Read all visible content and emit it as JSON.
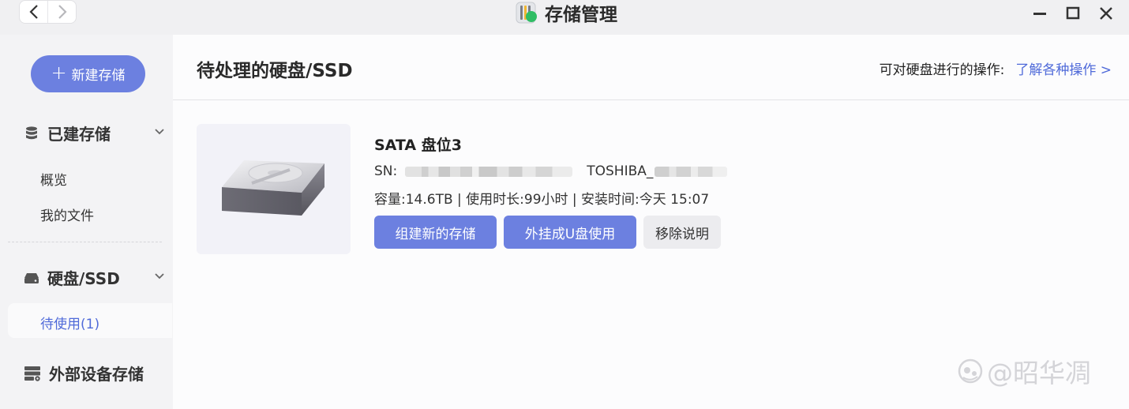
{
  "window": {
    "title": "存储管理",
    "controls": [
      "minimize-icon",
      "maximize-icon",
      "close-icon"
    ]
  },
  "sidebar": {
    "new_storage_label": "新建存储",
    "sections": [
      {
        "label": "已建存储",
        "icon": "database-icon",
        "items": [
          "概览",
          "我的文件"
        ]
      },
      {
        "label": "硬盘/SSD",
        "icon": "drive-icon",
        "items": [
          "待使用(1)"
        ]
      },
      {
        "label": "外部设备存储",
        "icon": "external-storage-icon",
        "items": []
      }
    ],
    "active_item": "待使用(1)"
  },
  "main": {
    "title": "待处理的硬盘/SSD",
    "ops_prefix": "可对硬盘进行的操作:",
    "ops_link": "了解各种操作 >",
    "disk": {
      "name": "SATA 盘位3",
      "sn_label": "SN:",
      "model_prefix": "TOSHIBA_",
      "capacity_line": "容量:14.6TB | 使用时长:99小时 | 安装时间:今天 15:07"
    },
    "buttons": {
      "create": "组建新的存储",
      "usb": "外挂成U盘使用",
      "remove_info": "移除说明"
    }
  },
  "watermark": {
    "text": "@昭华凋",
    "icon": "weibo-logo-icon"
  },
  "colors": {
    "accent": "#6c80e0",
    "link": "#4f6ad9",
    "sidebar_bg": "#f3f3f5",
    "main_bg": "#fcfcfd"
  }
}
